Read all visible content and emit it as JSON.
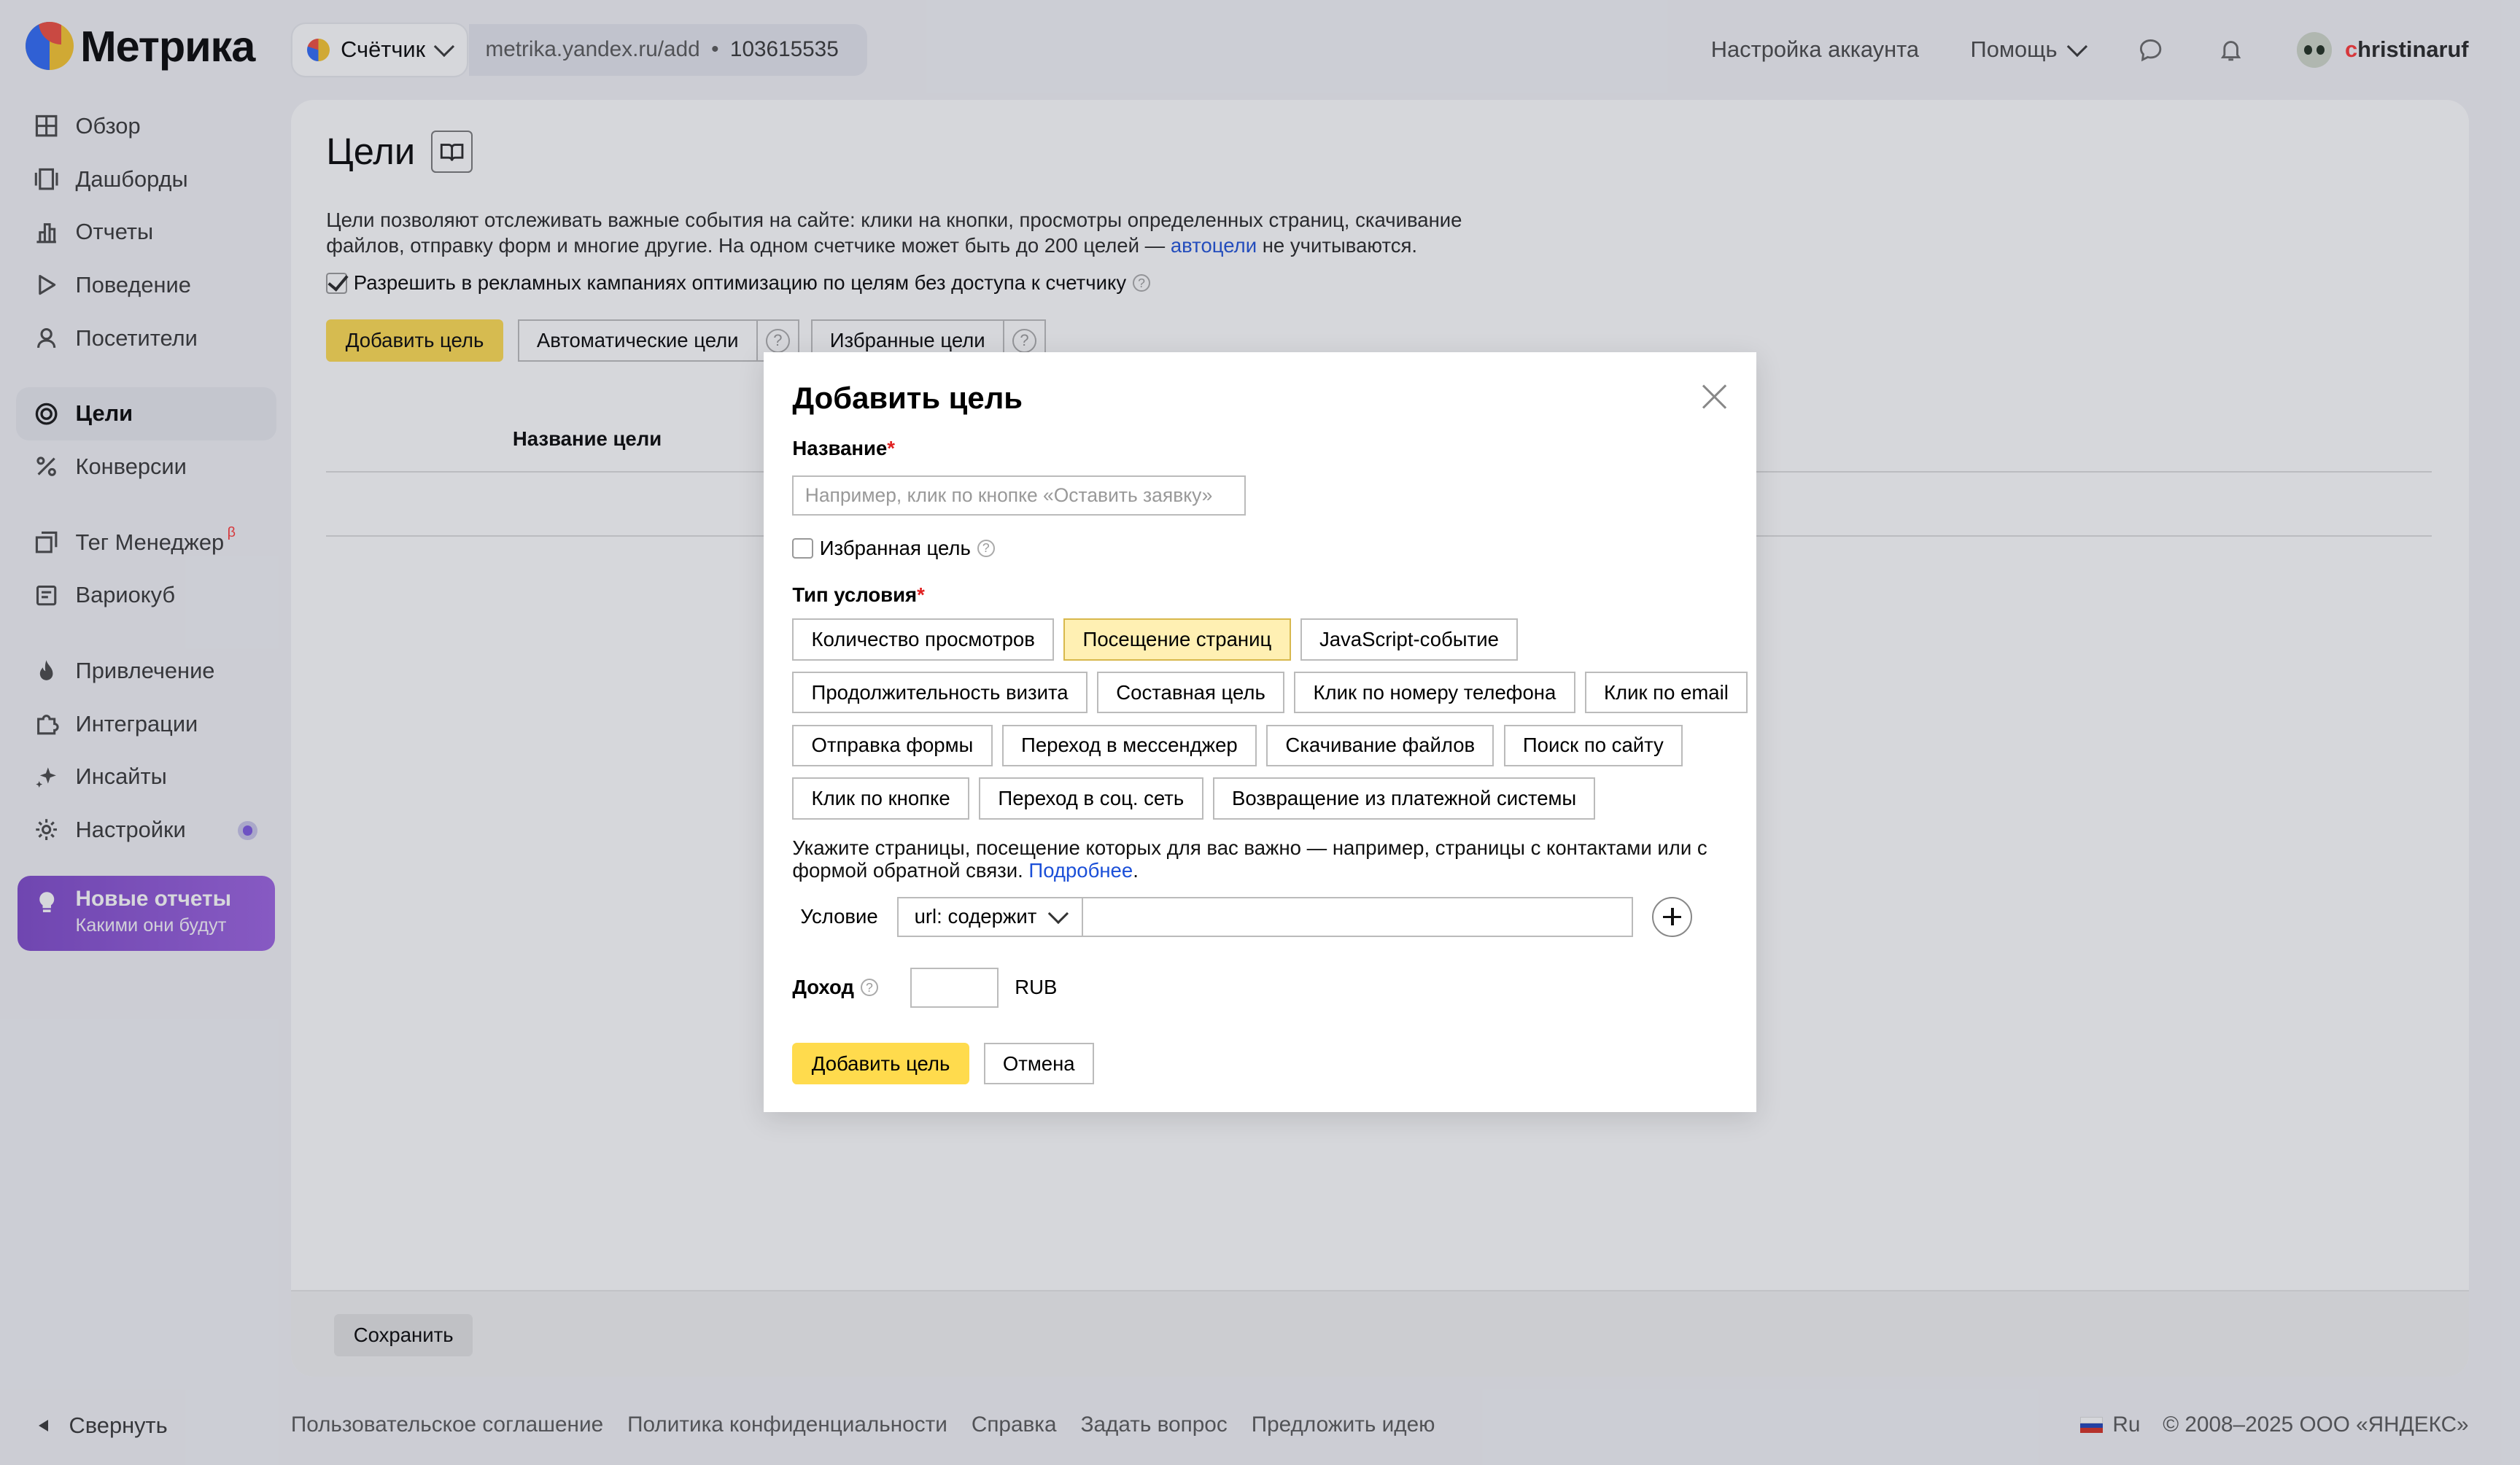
{
  "app": {
    "logo_text": "Метрика"
  },
  "topbar": {
    "counter_label": "Счётчик",
    "url": "metrika.yandex.ru/add",
    "separator": "•",
    "counter_id": "103615535",
    "account_settings": "Настройка аккаунта",
    "help": "Помощь",
    "username_first": "c",
    "username_rest": "hristinaruf"
  },
  "sidebar": {
    "items": [
      {
        "label": "Обзор",
        "icon": "grid-icon"
      },
      {
        "label": "Дашборды",
        "icon": "dashboards-icon"
      },
      {
        "label": "Отчеты",
        "icon": "bar-chart-icon"
      },
      {
        "label": "Поведение",
        "icon": "play-icon"
      },
      {
        "label": "Посетители",
        "icon": "person-icon"
      },
      {
        "label": "Цели",
        "icon": "target-icon",
        "active": true
      },
      {
        "label": "Конверсии",
        "icon": "percent-icon"
      },
      {
        "label": "Тег Менеджер",
        "sup": "β",
        "icon": "tag-manager-icon"
      },
      {
        "label": "Вариокуб",
        "icon": "variocube-icon"
      },
      {
        "label": "Привлечение",
        "icon": "flame-icon"
      },
      {
        "label": "Интеграции",
        "icon": "puzzle-icon"
      },
      {
        "label": "Инсайты",
        "icon": "sparkle-icon"
      },
      {
        "label": "Настройки",
        "icon": "gear-icon"
      }
    ],
    "promo_title": "Новые отчеты",
    "promo_subtitle": "Какими они будут",
    "collapse": "Свернуть"
  },
  "main": {
    "title": "Цели",
    "description_part1": "Цели позволяют отслеживать важные события на сайте: клики на кнопки, просмотры определенных страниц, скачивание файлов, отправку форм и многие другие. На одном счетчике может быть до 200 целей — ",
    "description_link": "автоцели",
    "description_part2": " не учитываются.",
    "allow_optimization": "Разрешить в рекламных кампаниях оптимизацию по целям без доступа к счетчику",
    "add_goal": "Добавить цель",
    "auto_goals": "Автоматические цели",
    "favorite_goals": "Избранные цели",
    "column_goal_name": "Название цели",
    "save": "Сохранить"
  },
  "modal": {
    "title": "Добавить цель",
    "name_label": "Название",
    "required_mark": "*",
    "name_placeholder": "Например, клик по кнопке «Оставить заявку»",
    "favorite_label": "Избранная цель",
    "condition_type_label": "Тип условия",
    "condition_types": [
      [
        "Количество просмотров",
        "Посещение страниц",
        "JavaScript-событие"
      ],
      [
        "Продолжительность визита",
        "Составная цель",
        "Клик по номеру телефона",
        "Клик по email"
      ],
      [
        "Отправка формы",
        "Переход в мессенджер",
        "Скачивание файлов",
        "Поиск по сайту"
      ],
      [
        "Клик по кнопке",
        "Переход в соц. сеть",
        "Возвращение из платежной системы"
      ]
    ],
    "selected_type": "Посещение страниц",
    "hint_text": "Укажите страницы, посещение которых для вас важно — например, страницы с контактами или с формой обратной связи. ",
    "hint_link": "Подробнее",
    "hint_end": ".",
    "condition_label": "Условие",
    "condition_select": "url: содержит",
    "condition_value": "",
    "income_label": "Доход",
    "currency": "RUB",
    "submit": "Добавить цель",
    "cancel": "Отмена"
  },
  "footer": {
    "links": [
      "Пользовательское соглашение",
      "Политика конфиденциальности",
      "Справка",
      "Задать вопрос",
      "Предложить идею"
    ],
    "lang": "Ru",
    "copyright": "© 2008–2025 ООО «ЯНДЕКС»"
  },
  "colors": {
    "accent_yellow": "#ffdb4d",
    "selected_type_bg": "#fff0b3",
    "link_blue": "#1b4fd8",
    "promo_purple": "#8a52d6"
  }
}
